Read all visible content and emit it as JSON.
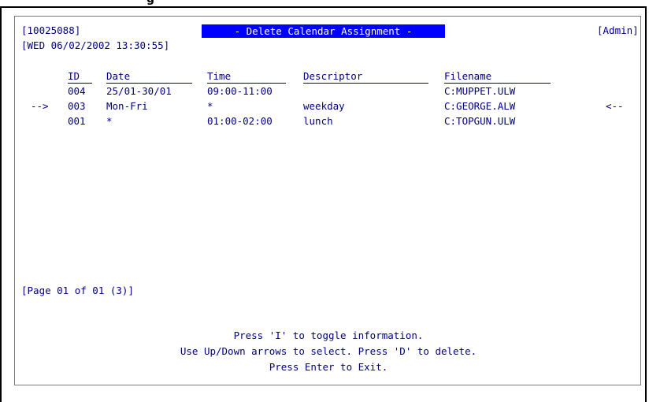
{
  "window": {
    "title_fragment": "g"
  },
  "header": {
    "terminal_id": "[10025088]",
    "screen_title": "- Delete Calendar Assignment -",
    "role": "[Admin]",
    "datetime": "[WED 06/02/2002 13:30:55]"
  },
  "table": {
    "columns": [
      "ID",
      "Date",
      "Time",
      "Descriptor",
      "Filename"
    ],
    "rows": [
      {
        "marker_left": "",
        "id": "004",
        "date": "25/01-30/01",
        "time": "09:00-11:00",
        "descriptor": "",
        "filename": "C:MUPPET.ULW",
        "marker_right": ""
      },
      {
        "marker_left": "-->",
        "id": "003",
        "date": "Mon-Fri",
        "time": "*",
        "descriptor": "weekday",
        "filename": "C:GEORGE.ALW",
        "marker_right": "<--"
      },
      {
        "marker_left": "",
        "id": "001",
        "date": "*",
        "time": "01:00-02:00",
        "descriptor": "lunch",
        "filename": "C:TOPGUN.ULW",
        "marker_right": ""
      }
    ]
  },
  "pagination": "[Page 01 of 01 (3)]",
  "footer": {
    "line1": "Press 'I' to toggle information.",
    "line2": "Use Up/Down arrows to select. Press 'D' to delete.",
    "line3": "Press Enter to Exit."
  },
  "colors": {
    "text": "#000080",
    "title_bar_bg": "#0000ff",
    "title_bar_text": "#ffffff"
  }
}
